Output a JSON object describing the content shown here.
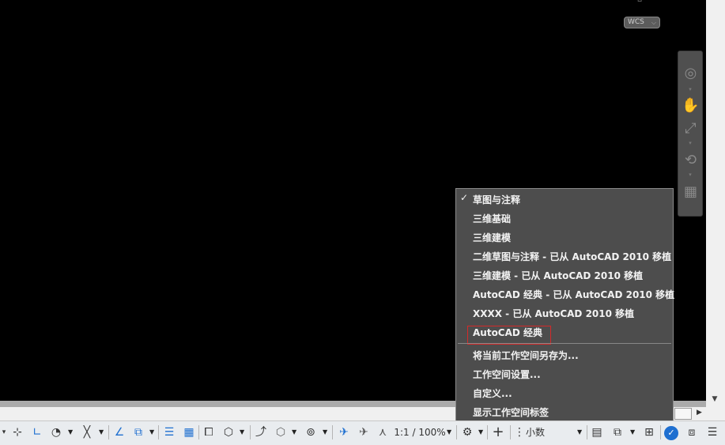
{
  "viewport": {
    "wcs_label": "WCS",
    "wcs_chevron": "⌵"
  },
  "navigation_bar": {
    "tools": [
      {
        "icon": "steering-wheel-icon",
        "glyph": "◎"
      },
      {
        "icon": "pan-hand-icon",
        "glyph": "✋"
      },
      {
        "icon": "zoom-icon",
        "glyph": "⤢"
      },
      {
        "icon": "orbit-icon",
        "glyph": "⟲"
      },
      {
        "icon": "showmotion-icon",
        "glyph": "▦"
      }
    ]
  },
  "workspace_menu": {
    "items": [
      {
        "label": "草图与注释",
        "checked": true
      },
      {
        "label": "三维基础"
      },
      {
        "label": "三维建模"
      },
      {
        "label": "二维草图与注释 - 已从 AutoCAD 2010 移植"
      },
      {
        "label": "三维建模 - 已从 AutoCAD 2010 移植"
      },
      {
        "label": "AutoCAD 经典 - 已从 AutoCAD 2010 移植"
      },
      {
        "label": "XXXX - 已从 AutoCAD 2010 移植"
      },
      {
        "label": "AutoCAD 经典",
        "highlighted": true
      }
    ],
    "actions": [
      {
        "label": "将当前工作空间另存为..."
      },
      {
        "label": "工作空间设置..."
      },
      {
        "label": "自定义..."
      },
      {
        "label": "显示工作空间标签"
      }
    ],
    "check_glyph": "✓",
    "highlight_color": "#d42a2a"
  },
  "status_bar": {
    "annotation_scale": "1:1 / 100%",
    "units": "小数",
    "accent_color": "#1e6fd0"
  }
}
